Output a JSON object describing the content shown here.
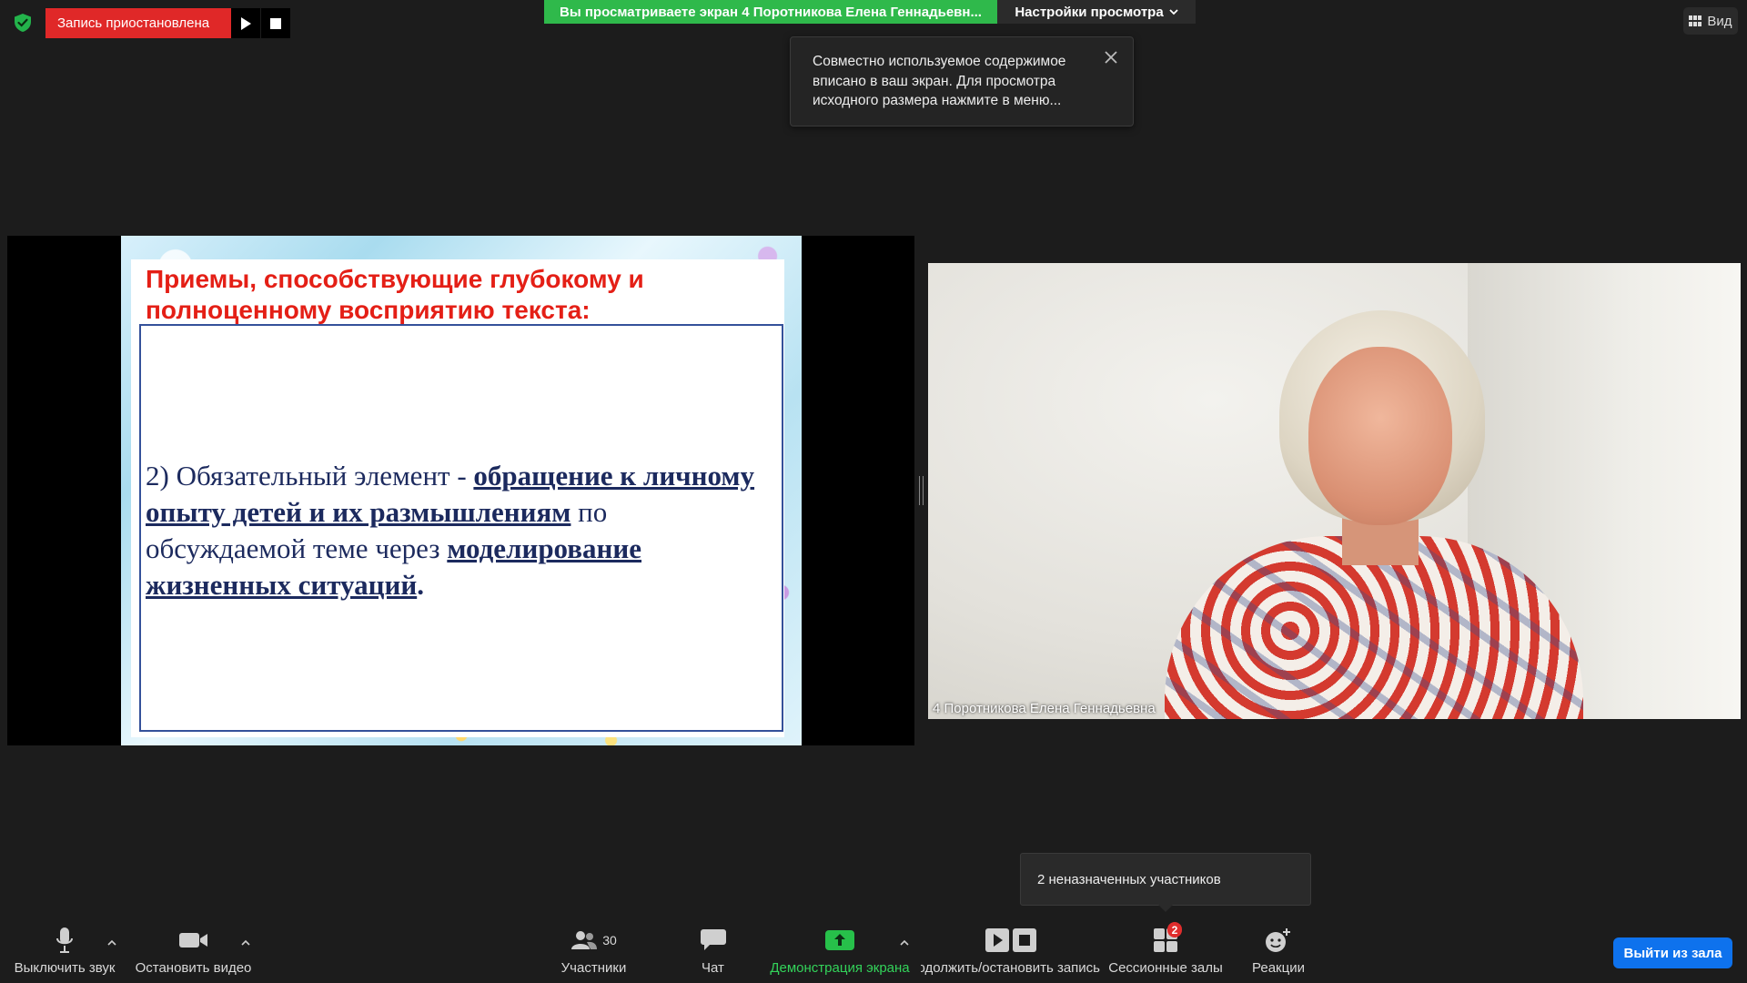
{
  "top": {
    "recording_status": "Запись приостановлена",
    "viewing_banner": "Вы просматриваете экран 4 Поротникова Елена Геннадьевн...",
    "view_options": "Настройки просмотра",
    "view_button": "Вид"
  },
  "tooltip": {
    "text": "Совместно используемое содержимое вписано в ваш экран. Для просмотра исходного размера нажмите в меню..."
  },
  "slide": {
    "title": "Приемы, способствующие глубокому и полноценному восприятию текста:",
    "body_part1": "2) Обязательный элемент - ",
    "body_link1": "обращение к личному опыту детей и их размышлениям",
    "body_part2": " по обсуждаемой теме через ",
    "body_link2": "моделирование жизненных ситуаций",
    "body_end": "."
  },
  "video": {
    "participant_name": "4 Поротникова Елена Геннадьевна"
  },
  "breakout_popup": {
    "text": "2 неназначенных участников"
  },
  "toolbar": {
    "mute_label": "Выключить звук",
    "video_label": "Остановить видео",
    "participants_label": "Участники",
    "participants_count": "30",
    "chat_label": "Чат",
    "share_label": "Демонстрация экрана",
    "recording_label": "продолжить/остановить запись",
    "breakout_label": "Сессионные залы",
    "breakout_badge": "2",
    "reactions_label": "Реакции",
    "leave_label": "Выйти из зала"
  },
  "colors": {
    "recording_red": "#e02828",
    "banner_green": "#2fb94b",
    "leave_blue": "#0e72ed",
    "slide_title_red": "#e41f16",
    "slide_text_navy": "#1c2a5e"
  }
}
